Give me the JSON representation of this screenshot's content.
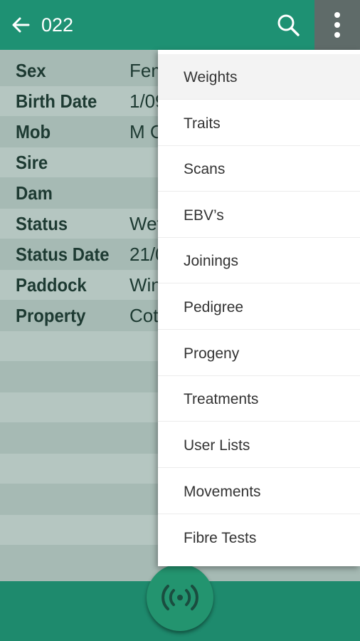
{
  "header": {
    "title": "022",
    "back_icon": "arrow-left-icon",
    "search_icon": "search-icon",
    "overflow_icon": "more-vertical-icon"
  },
  "details": [
    {
      "label": "Sex",
      "value": "Fem"
    },
    {
      "label": "Birth Date",
      "value": "1/09"
    },
    {
      "label": "Mob",
      "value": "M C"
    },
    {
      "label": "Sire",
      "value": ""
    },
    {
      "label": "Dam",
      "value": ""
    },
    {
      "label": "Status",
      "value": "Wet"
    },
    {
      "label": "Status Date",
      "value": "21/0"
    },
    {
      "label": "Paddock",
      "value": "Win"
    },
    {
      "label": "Property",
      "value": "Cotr"
    }
  ],
  "menu": {
    "items": [
      {
        "label": "Weights"
      },
      {
        "label": "Traits"
      },
      {
        "label": "Scans"
      },
      {
        "label": "EBV’s"
      },
      {
        "label": "Joinings"
      },
      {
        "label": "Pedigree"
      },
      {
        "label": "Progeny"
      },
      {
        "label": "Treatments"
      },
      {
        "label": "User Lists"
      },
      {
        "label": "Movements"
      },
      {
        "label": "Fibre Tests"
      }
    ]
  },
  "fab": {
    "icon": "rfid-scan-icon"
  },
  "colors": {
    "primary": "#1e9173",
    "overlay": "#a6bab4",
    "menu_background": "#ffffff",
    "text_dark": "#1d3a32"
  }
}
